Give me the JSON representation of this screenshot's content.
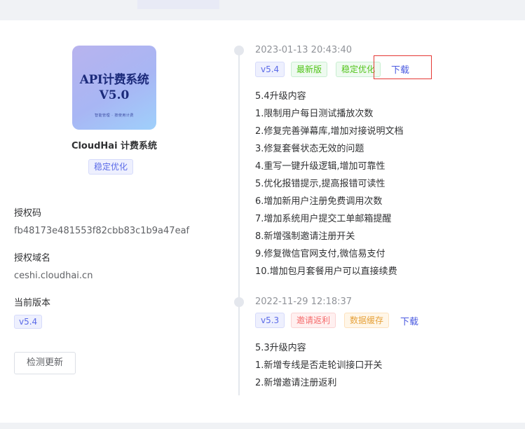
{
  "product": {
    "image_title": "API计费系统",
    "image_version": "V5.0",
    "image_subtitle": "智能管理 · 按使用计费",
    "name": "CloudHai 计费系统",
    "status_tag": "稳定优化"
  },
  "license": {
    "code_label": "授权码",
    "code_value": "fb48173e481553f82cbb83c1b9a47eaf",
    "domain_label": "授权域名",
    "domain_value": "ceshi.cloudhai.cn",
    "version_label": "当前版本",
    "version_value": "v5.4",
    "check_button": "检测更新"
  },
  "releases": [
    {
      "timestamp": "2023-01-13 20:43:40",
      "tags": [
        "v5.4",
        "最新版",
        "稳定优化"
      ],
      "download": "下载",
      "lines": [
        "5.4升级内容",
        "1.限制用户每日测试播放次数",
        "2.修复完善弹幕库,增加对接说明文档",
        "3.修复套餐状态无效的问题",
        "4.重写一键升级逻辑,增加可靠性",
        "5.优化报错提示,提高报错可读性",
        "6.增加新用户注册免费调用次数",
        "7.增加系统用户提交工单邮箱提醒",
        "8.新增强制邀请注册开关",
        "9.修复微信官网支付,微信易支付",
        "10.增加包月套餐用户可以直接续费"
      ]
    },
    {
      "timestamp": "2022-11-29 12:18:37",
      "tags": [
        "v5.3",
        "邀请返利",
        "数据缓存"
      ],
      "download": "下载",
      "lines": [
        "5.3升级内容",
        "1.新增专线是否走轮训接口开关",
        "2.新增邀请注册返利"
      ]
    }
  ],
  "colors": {
    "accent": "#4a5ae0",
    "tag_blue": "#5b6be8",
    "tag_green": "#52c41a",
    "tag_red": "#f56c6c",
    "tag_orange": "#e6a23c",
    "highlight": "#e53935"
  }
}
